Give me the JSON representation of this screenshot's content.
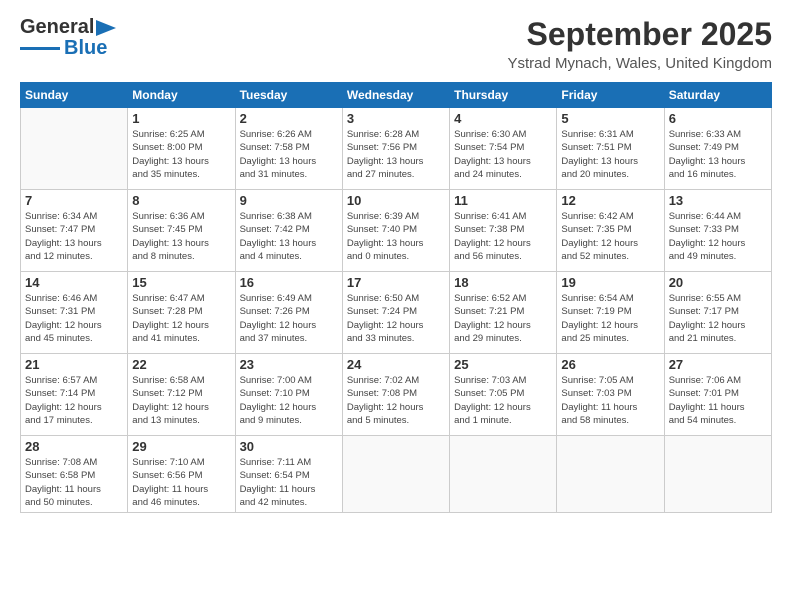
{
  "header": {
    "logo_line1": "General",
    "logo_line2": "Blue",
    "month": "September 2025",
    "location": "Ystrad Mynach, Wales, United Kingdom"
  },
  "weekdays": [
    "Sunday",
    "Monday",
    "Tuesday",
    "Wednesday",
    "Thursday",
    "Friday",
    "Saturday"
  ],
  "weeks": [
    [
      {
        "day": "",
        "info": ""
      },
      {
        "day": "1",
        "info": "Sunrise: 6:25 AM\nSunset: 8:00 PM\nDaylight: 13 hours\nand 35 minutes."
      },
      {
        "day": "2",
        "info": "Sunrise: 6:26 AM\nSunset: 7:58 PM\nDaylight: 13 hours\nand 31 minutes."
      },
      {
        "day": "3",
        "info": "Sunrise: 6:28 AM\nSunset: 7:56 PM\nDaylight: 13 hours\nand 27 minutes."
      },
      {
        "day": "4",
        "info": "Sunrise: 6:30 AM\nSunset: 7:54 PM\nDaylight: 13 hours\nand 24 minutes."
      },
      {
        "day": "5",
        "info": "Sunrise: 6:31 AM\nSunset: 7:51 PM\nDaylight: 13 hours\nand 20 minutes."
      },
      {
        "day": "6",
        "info": "Sunrise: 6:33 AM\nSunset: 7:49 PM\nDaylight: 13 hours\nand 16 minutes."
      }
    ],
    [
      {
        "day": "7",
        "info": "Sunrise: 6:34 AM\nSunset: 7:47 PM\nDaylight: 13 hours\nand 12 minutes."
      },
      {
        "day": "8",
        "info": "Sunrise: 6:36 AM\nSunset: 7:45 PM\nDaylight: 13 hours\nand 8 minutes."
      },
      {
        "day": "9",
        "info": "Sunrise: 6:38 AM\nSunset: 7:42 PM\nDaylight: 13 hours\nand 4 minutes."
      },
      {
        "day": "10",
        "info": "Sunrise: 6:39 AM\nSunset: 7:40 PM\nDaylight: 13 hours\nand 0 minutes."
      },
      {
        "day": "11",
        "info": "Sunrise: 6:41 AM\nSunset: 7:38 PM\nDaylight: 12 hours\nand 56 minutes."
      },
      {
        "day": "12",
        "info": "Sunrise: 6:42 AM\nSunset: 7:35 PM\nDaylight: 12 hours\nand 52 minutes."
      },
      {
        "day": "13",
        "info": "Sunrise: 6:44 AM\nSunset: 7:33 PM\nDaylight: 12 hours\nand 49 minutes."
      }
    ],
    [
      {
        "day": "14",
        "info": "Sunrise: 6:46 AM\nSunset: 7:31 PM\nDaylight: 12 hours\nand 45 minutes."
      },
      {
        "day": "15",
        "info": "Sunrise: 6:47 AM\nSunset: 7:28 PM\nDaylight: 12 hours\nand 41 minutes."
      },
      {
        "day": "16",
        "info": "Sunrise: 6:49 AM\nSunset: 7:26 PM\nDaylight: 12 hours\nand 37 minutes."
      },
      {
        "day": "17",
        "info": "Sunrise: 6:50 AM\nSunset: 7:24 PM\nDaylight: 12 hours\nand 33 minutes."
      },
      {
        "day": "18",
        "info": "Sunrise: 6:52 AM\nSunset: 7:21 PM\nDaylight: 12 hours\nand 29 minutes."
      },
      {
        "day": "19",
        "info": "Sunrise: 6:54 AM\nSunset: 7:19 PM\nDaylight: 12 hours\nand 25 minutes."
      },
      {
        "day": "20",
        "info": "Sunrise: 6:55 AM\nSunset: 7:17 PM\nDaylight: 12 hours\nand 21 minutes."
      }
    ],
    [
      {
        "day": "21",
        "info": "Sunrise: 6:57 AM\nSunset: 7:14 PM\nDaylight: 12 hours\nand 17 minutes."
      },
      {
        "day": "22",
        "info": "Sunrise: 6:58 AM\nSunset: 7:12 PM\nDaylight: 12 hours\nand 13 minutes."
      },
      {
        "day": "23",
        "info": "Sunrise: 7:00 AM\nSunset: 7:10 PM\nDaylight: 12 hours\nand 9 minutes."
      },
      {
        "day": "24",
        "info": "Sunrise: 7:02 AM\nSunset: 7:08 PM\nDaylight: 12 hours\nand 5 minutes."
      },
      {
        "day": "25",
        "info": "Sunrise: 7:03 AM\nSunset: 7:05 PM\nDaylight: 12 hours\nand 1 minute."
      },
      {
        "day": "26",
        "info": "Sunrise: 7:05 AM\nSunset: 7:03 PM\nDaylight: 11 hours\nand 58 minutes."
      },
      {
        "day": "27",
        "info": "Sunrise: 7:06 AM\nSunset: 7:01 PM\nDaylight: 11 hours\nand 54 minutes."
      }
    ],
    [
      {
        "day": "28",
        "info": "Sunrise: 7:08 AM\nSunset: 6:58 PM\nDaylight: 11 hours\nand 50 minutes."
      },
      {
        "day": "29",
        "info": "Sunrise: 7:10 AM\nSunset: 6:56 PM\nDaylight: 11 hours\nand 46 minutes."
      },
      {
        "day": "30",
        "info": "Sunrise: 7:11 AM\nSunset: 6:54 PM\nDaylight: 11 hours\nand 42 minutes."
      },
      {
        "day": "",
        "info": ""
      },
      {
        "day": "",
        "info": ""
      },
      {
        "day": "",
        "info": ""
      },
      {
        "day": "",
        "info": ""
      }
    ]
  ]
}
